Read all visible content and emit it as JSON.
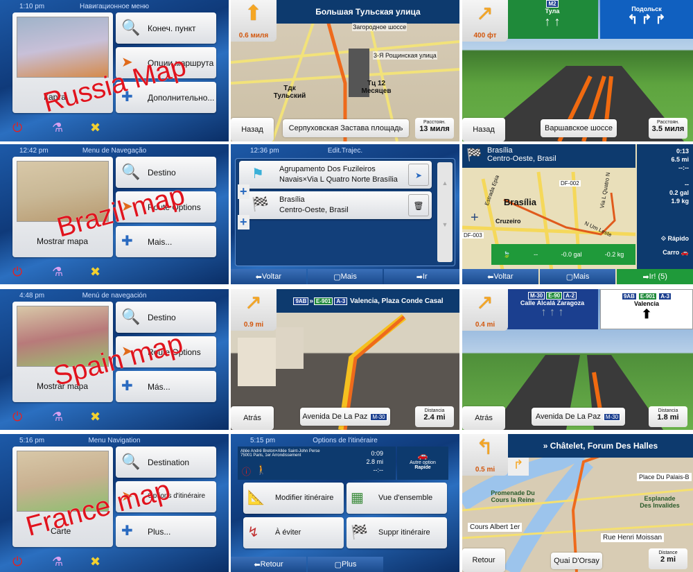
{
  "colors": {
    "accent_blue": "#0d3a6e",
    "route_orange": "#f08a2a",
    "watermark_red": "#e0141e",
    "go_green": "#1f9a3a"
  },
  "russia": {
    "menu": {
      "time": "1:10 pm",
      "title": "Навигационное меню",
      "map_label": "Карта",
      "buttons": [
        "Конеч. пункт",
        "Опции маршрута",
        "Дополнительно..."
      ],
      "watermark": "Russia Map"
    },
    "nav": {
      "street_top": "Большая Тульская улица",
      "distance_turn": "0.6 миля",
      "labels": [
        "Загородное шоссе",
        "3-Я Рощинская улица",
        "Тдк Тульский",
        "Тц 12 Месяцев"
      ],
      "back": "Назад",
      "current_street": "Серпуховская Застава площадь",
      "dist_label": "Расстоян.",
      "dist_value": "13 миля"
    },
    "junction": {
      "distance_turn": "400 фт",
      "sign_left_shield": "M2",
      "sign_left_city": "Тула",
      "sign_right_city": "Подольск",
      "back": "Назад",
      "current_street": "Варшавское шоссе",
      "dist_label": "Расстоян.",
      "dist_value": "3.5 миля"
    }
  },
  "brazil": {
    "menu": {
      "time": "12:42 pm",
      "title": "Menu de Navegação",
      "map_label": "Mostrar mapa",
      "buttons": [
        "Destino",
        "Route Options",
        "Mais..."
      ],
      "watermark": "Brazil map"
    },
    "edit": {
      "time": "12:36 pm",
      "title": "Edit.Trajec.",
      "waypoints": [
        {
          "line1": "Agrupamento Dos Fuzileiros",
          "line2": "Navais×Via L Quatro Norte Brasília"
        },
        {
          "line1": "Brasília",
          "line2": "Centro-Oeste, Brasil"
        }
      ],
      "buttons": [
        "Voltar",
        "Mais",
        "Ir"
      ]
    },
    "summary": {
      "dest1": "Brasília",
      "dest2": "Centro-Oeste, Brasil",
      "map_labels": [
        "Brasília",
        "Cruzeiro",
        "DF-002",
        "DF-003",
        "Estrada Epia",
        "Via L Quatro N",
        "N Um Leste"
      ],
      "time": "0:13",
      "distance": "6.5 mi",
      "eta": "--:--",
      "fuel_dash": "--",
      "fuel": "0.2 gal",
      "co2": "1.9 kg",
      "eco_dash": "--",
      "eco_fuel": "-0.0 gal",
      "eco_co2": "-0.2 kg",
      "route_type": "Rápido",
      "vehicle": "Carro",
      "buttons": [
        "Voltar",
        "Mais",
        "Ir! (5)"
      ]
    }
  },
  "spain": {
    "menu": {
      "time": "4:48 pm",
      "title": "Menú de navegación",
      "map_label": "Mostrar mapa",
      "buttons": [
        "Destino",
        "Route Options",
        "Más..."
      ],
      "watermark": "Spain map"
    },
    "nav": {
      "exit": "9AB",
      "shields": [
        "E-901",
        "A-3"
      ],
      "street_top": "Valencia, Plaza Conde Casal",
      "distance_turn": "0.9 mi",
      "back": "Atrás",
      "current_street": "Avenida De La Paz",
      "current_shield": "M-30",
      "dist_label": "Distancia",
      "dist_value": "2.4 mi"
    },
    "junction": {
      "distance_turn": "0.4 mi",
      "left_shields": [
        "M-30",
        "E-90",
        "A-2"
      ],
      "left_text": "Calle Alcalá  Zaragoza",
      "right_exit": "9AB",
      "right_shields": [
        "E-901",
        "A-3"
      ],
      "right_text": "Valencia",
      "back": "Atrás",
      "current_street": "Avenida De La Paz",
      "current_shield": "M-30",
      "dist_label": "Distancia",
      "dist_value": "1.8 mi"
    }
  },
  "france": {
    "menu": {
      "time": "5:16 pm",
      "title": "Menu Navigation",
      "map_label": "Carte",
      "buttons": [
        "Destination",
        "Options d'itinéraire",
        "Plus..."
      ],
      "watermark": "France map"
    },
    "options": {
      "time": "5:15 pm",
      "title": "Options de l'itinéraire",
      "address": "Allée André Breton×Allée Saint-John Perse 75001 Paris, 1er Arrondissement",
      "time_value": "0:09",
      "distance": "2.8 mi",
      "eta": "--:--",
      "alt_label": "Autre option",
      "alt_value": "Rapide",
      "buttons": [
        "Modifier itinéraire",
        "Vue d'ensemble",
        "À éviter",
        "Suppr itinéraire"
      ],
      "bottom": [
        "Retour",
        "Plus"
      ]
    },
    "nav": {
      "street_top": "» Châtelet, Forum Des Halles",
      "distance_turn": "0.5 mi",
      "labels": [
        "Place Du Palais-B",
        "Promenade Du Cours la Reine",
        "Esplanade Des Invalides",
        "Cours Albert 1er",
        "Rue Henri Moissan"
      ],
      "back": "Retour",
      "current_street": "Quai D'Orsay",
      "dist_label": "Distance",
      "dist_value": "2 mi"
    }
  }
}
